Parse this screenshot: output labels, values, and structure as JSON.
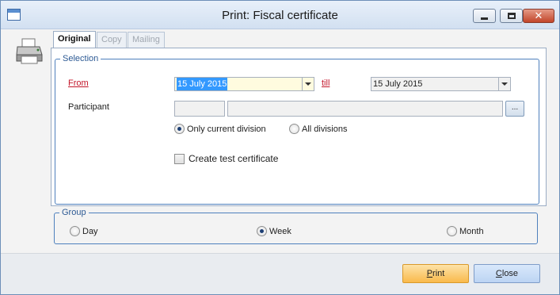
{
  "window": {
    "title": "Print: Fiscal certificate",
    "icon": "window-icon",
    "controls": [
      "minimize-icon",
      "maximize-icon",
      "close-icon"
    ]
  },
  "tabs": [
    {
      "label": "Original",
      "active": true
    },
    {
      "label": "Copy",
      "active": false
    },
    {
      "label": "Mailing",
      "active": false
    }
  ],
  "selection": {
    "legend": "Selection",
    "from_label": "From",
    "from_value": "15 July 2015",
    "till_label": "till",
    "till_value": "15 July 2015",
    "participant_label": "Participant",
    "participant_code": "",
    "participant_name": "",
    "browse_label": "...",
    "division_options": [
      {
        "label": "Only current division",
        "checked": true
      },
      {
        "label": "All divisions",
        "checked": false
      }
    ],
    "test_certificate_label": "Create test certificate",
    "test_certificate_checked": false
  },
  "group": {
    "legend": "Group",
    "options": [
      {
        "label": "Day",
        "checked": false
      },
      {
        "label": "Week",
        "checked": true
      },
      {
        "label": "Month",
        "checked": false
      }
    ]
  },
  "buttons": {
    "print_mnemonic": "P",
    "print_rest": "rint",
    "close_mnemonic": "C",
    "close_rest": "lose"
  },
  "colors": {
    "link_red": "#c3162a",
    "primary_button": "#f9b94c",
    "group_border": "#4e80bd"
  }
}
